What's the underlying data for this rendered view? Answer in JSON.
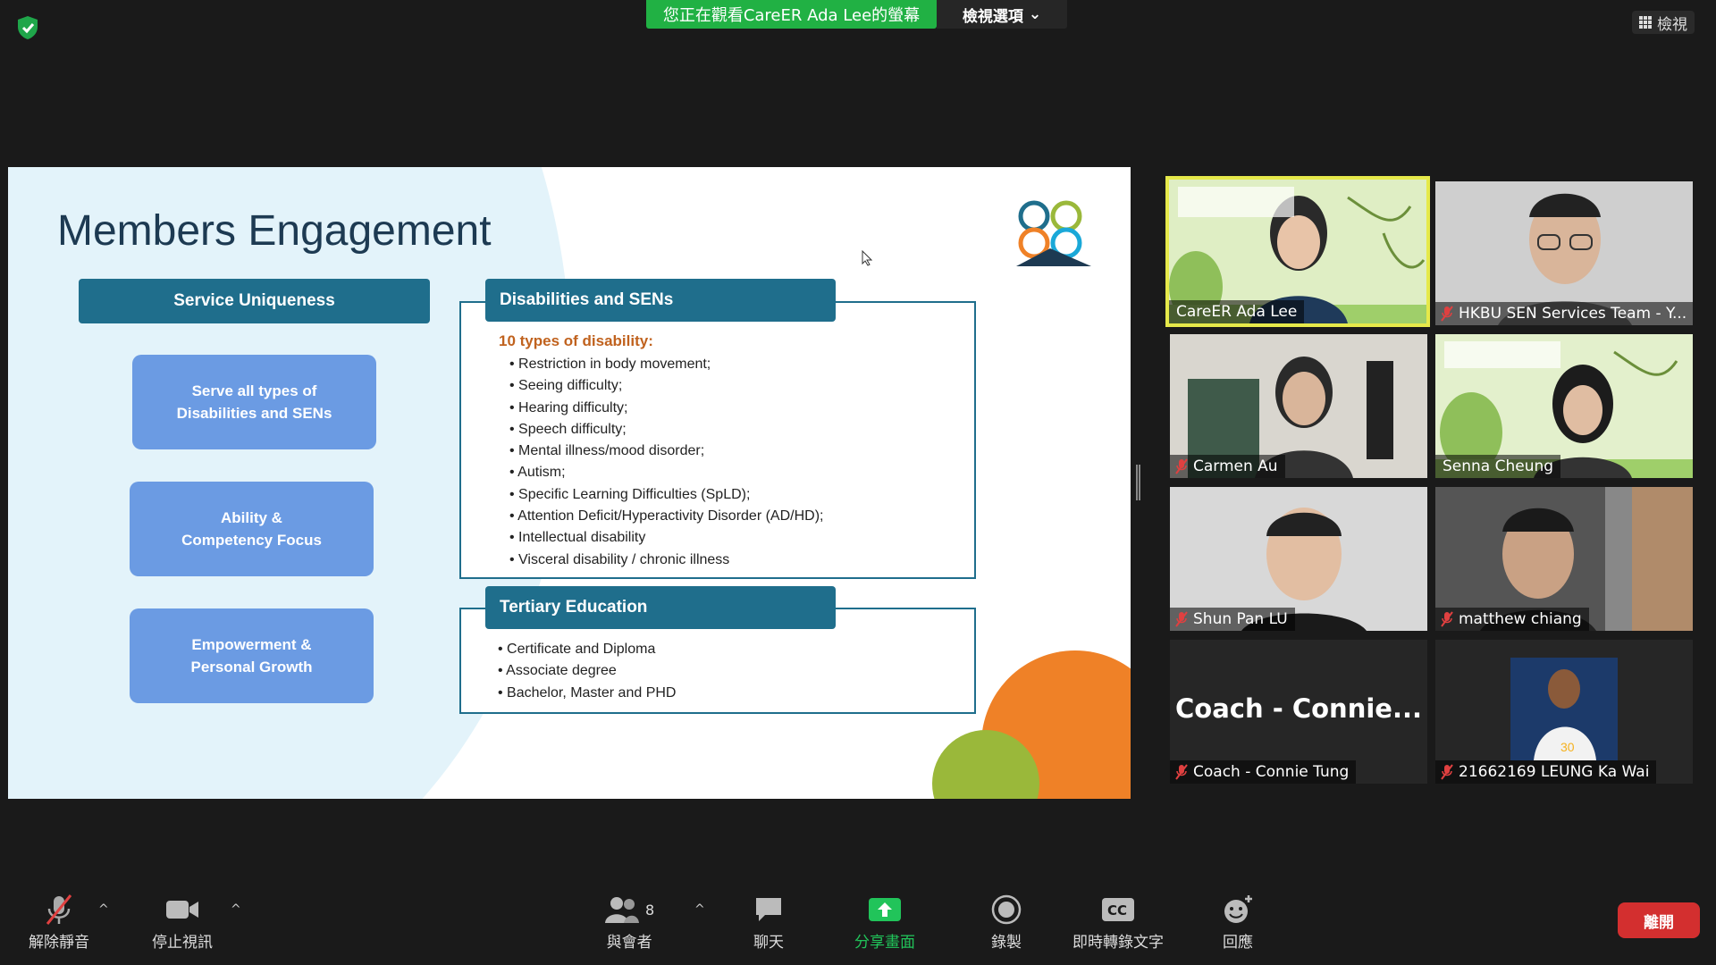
{
  "app": {
    "security_icon": "shield-check-icon",
    "share_banner": "您正在觀看CareER Ada Lee的螢幕",
    "view_options_label": "檢視選項",
    "view_button_label": "檢視"
  },
  "slide": {
    "title": "Members Engagement",
    "service_header": "Service Uniqueness",
    "pills": [
      {
        "line1": "Serve all types of",
        "line2": "Disabilities and SENs"
      },
      {
        "line1": "Ability &",
        "line2": "Competency Focus"
      },
      {
        "line1": "Empowerment &",
        "line2": "Personal Growth"
      }
    ],
    "disabilities": {
      "header": "Disabilities and SENs",
      "subtitle": "10 types of disability:",
      "items": [
        "Restriction in body movement;",
        "Seeing difficulty;",
        "Hearing difficulty;",
        "Speech difficulty;",
        "Mental illness/mood disorder;",
        "Autism;",
        "Specific Learning Difficulties (SpLD);",
        "Attention Deficit/Hyperactivity Disorder (AD/HD);",
        "Intellectual disability",
        "Visceral disability / chronic illness"
      ]
    },
    "tertiary": {
      "header": "Tertiary Education",
      "items": [
        "Certificate and Diploma",
        "Associate degree",
        "Bachelor, Master and PHD"
      ]
    },
    "colors": {
      "primary": "#1f6e8c",
      "pill": "#6b9be3",
      "accent_orange": "#ef8127",
      "accent_green": "#9ab83a"
    }
  },
  "participants": [
    {
      "name": "CareER Ada Lee",
      "muted": false,
      "active": true
    },
    {
      "name": "HKBU SEN Services Team - Y...",
      "muted": true
    },
    {
      "name": "Carmen Au",
      "muted": true
    },
    {
      "name": "Senna Cheung",
      "muted": false
    },
    {
      "name": "Shun Pan LU",
      "muted": true
    },
    {
      "name": "matthew chiang",
      "muted": true
    },
    {
      "name": "Coach - Connie Tung",
      "muted": true,
      "display_text": "Coach - Connie..."
    },
    {
      "name": "21662169 LEUNG Ka Wai",
      "muted": true
    }
  ],
  "toolbar": {
    "unmute": "解除靜音",
    "stop_video": "停止視訊",
    "participants": "與會者",
    "participants_count": "8",
    "chat": "聊天",
    "share_screen": "分享畫面",
    "record": "錄製",
    "live_transcript": "即時轉錄文字",
    "reactions": "回應",
    "leave": "離開",
    "cc_label": "CC"
  }
}
